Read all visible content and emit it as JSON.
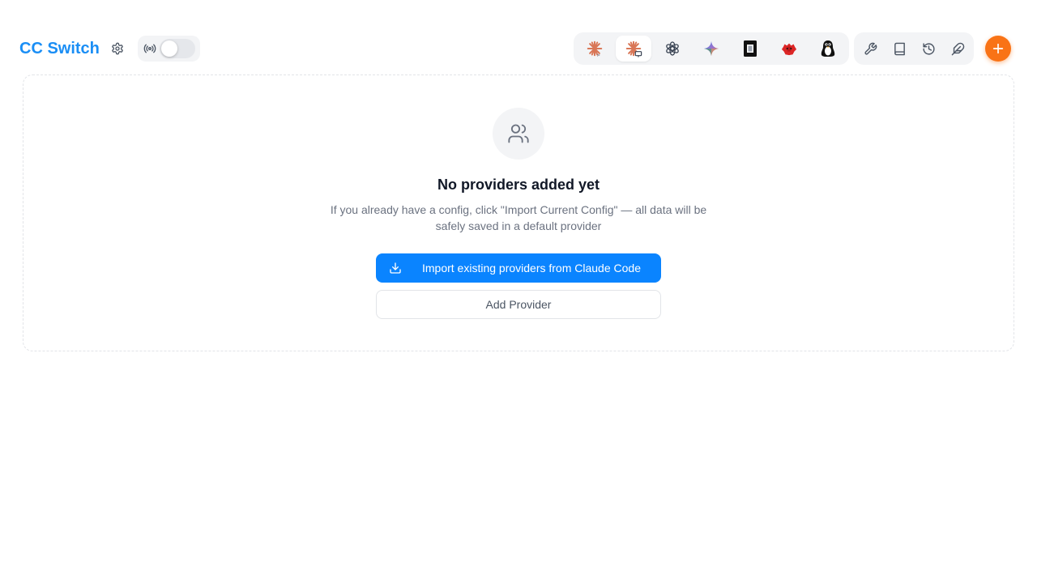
{
  "header": {
    "app_title": "CC Switch",
    "accent_color": "#1a8ef5",
    "settings_icon": "gear-icon",
    "proxy": {
      "icon": "broadcast-icon",
      "enabled": false
    },
    "app_switcher": [
      {
        "name": "claude-code",
        "icon": "claude-starburst-icon",
        "active": false
      },
      {
        "name": "claude-desktop",
        "icon": "claude-desktop-icon",
        "active": true
      },
      {
        "name": "codex",
        "icon": "openai-icon",
        "active": false
      },
      {
        "name": "gemini",
        "icon": "gemini-sparkle-icon",
        "active": false
      },
      {
        "name": "app-5",
        "icon": "black-square-icon",
        "active": false
      },
      {
        "name": "app-6",
        "icon": "red-creature-icon",
        "active": false
      },
      {
        "name": "app-7",
        "icon": "penguin-icon",
        "active": false
      }
    ],
    "tools": [
      {
        "name": "tools",
        "icon": "wrench-icon"
      },
      {
        "name": "docs",
        "icon": "book-icon"
      },
      {
        "name": "history",
        "icon": "history-icon"
      },
      {
        "name": "skills",
        "icon": "feather-icon"
      }
    ],
    "add_button": {
      "icon": "plus-icon",
      "color": "#f97316"
    }
  },
  "empty_state": {
    "icon": "users-icon",
    "title": "No providers added yet",
    "description": "If you already have a config, click \"Import Current Config\" — all data will be safely saved in a default provider",
    "import_button": "Import existing providers from Claude Code",
    "add_button": "Add Provider",
    "primary_color": "#0a84ff"
  }
}
